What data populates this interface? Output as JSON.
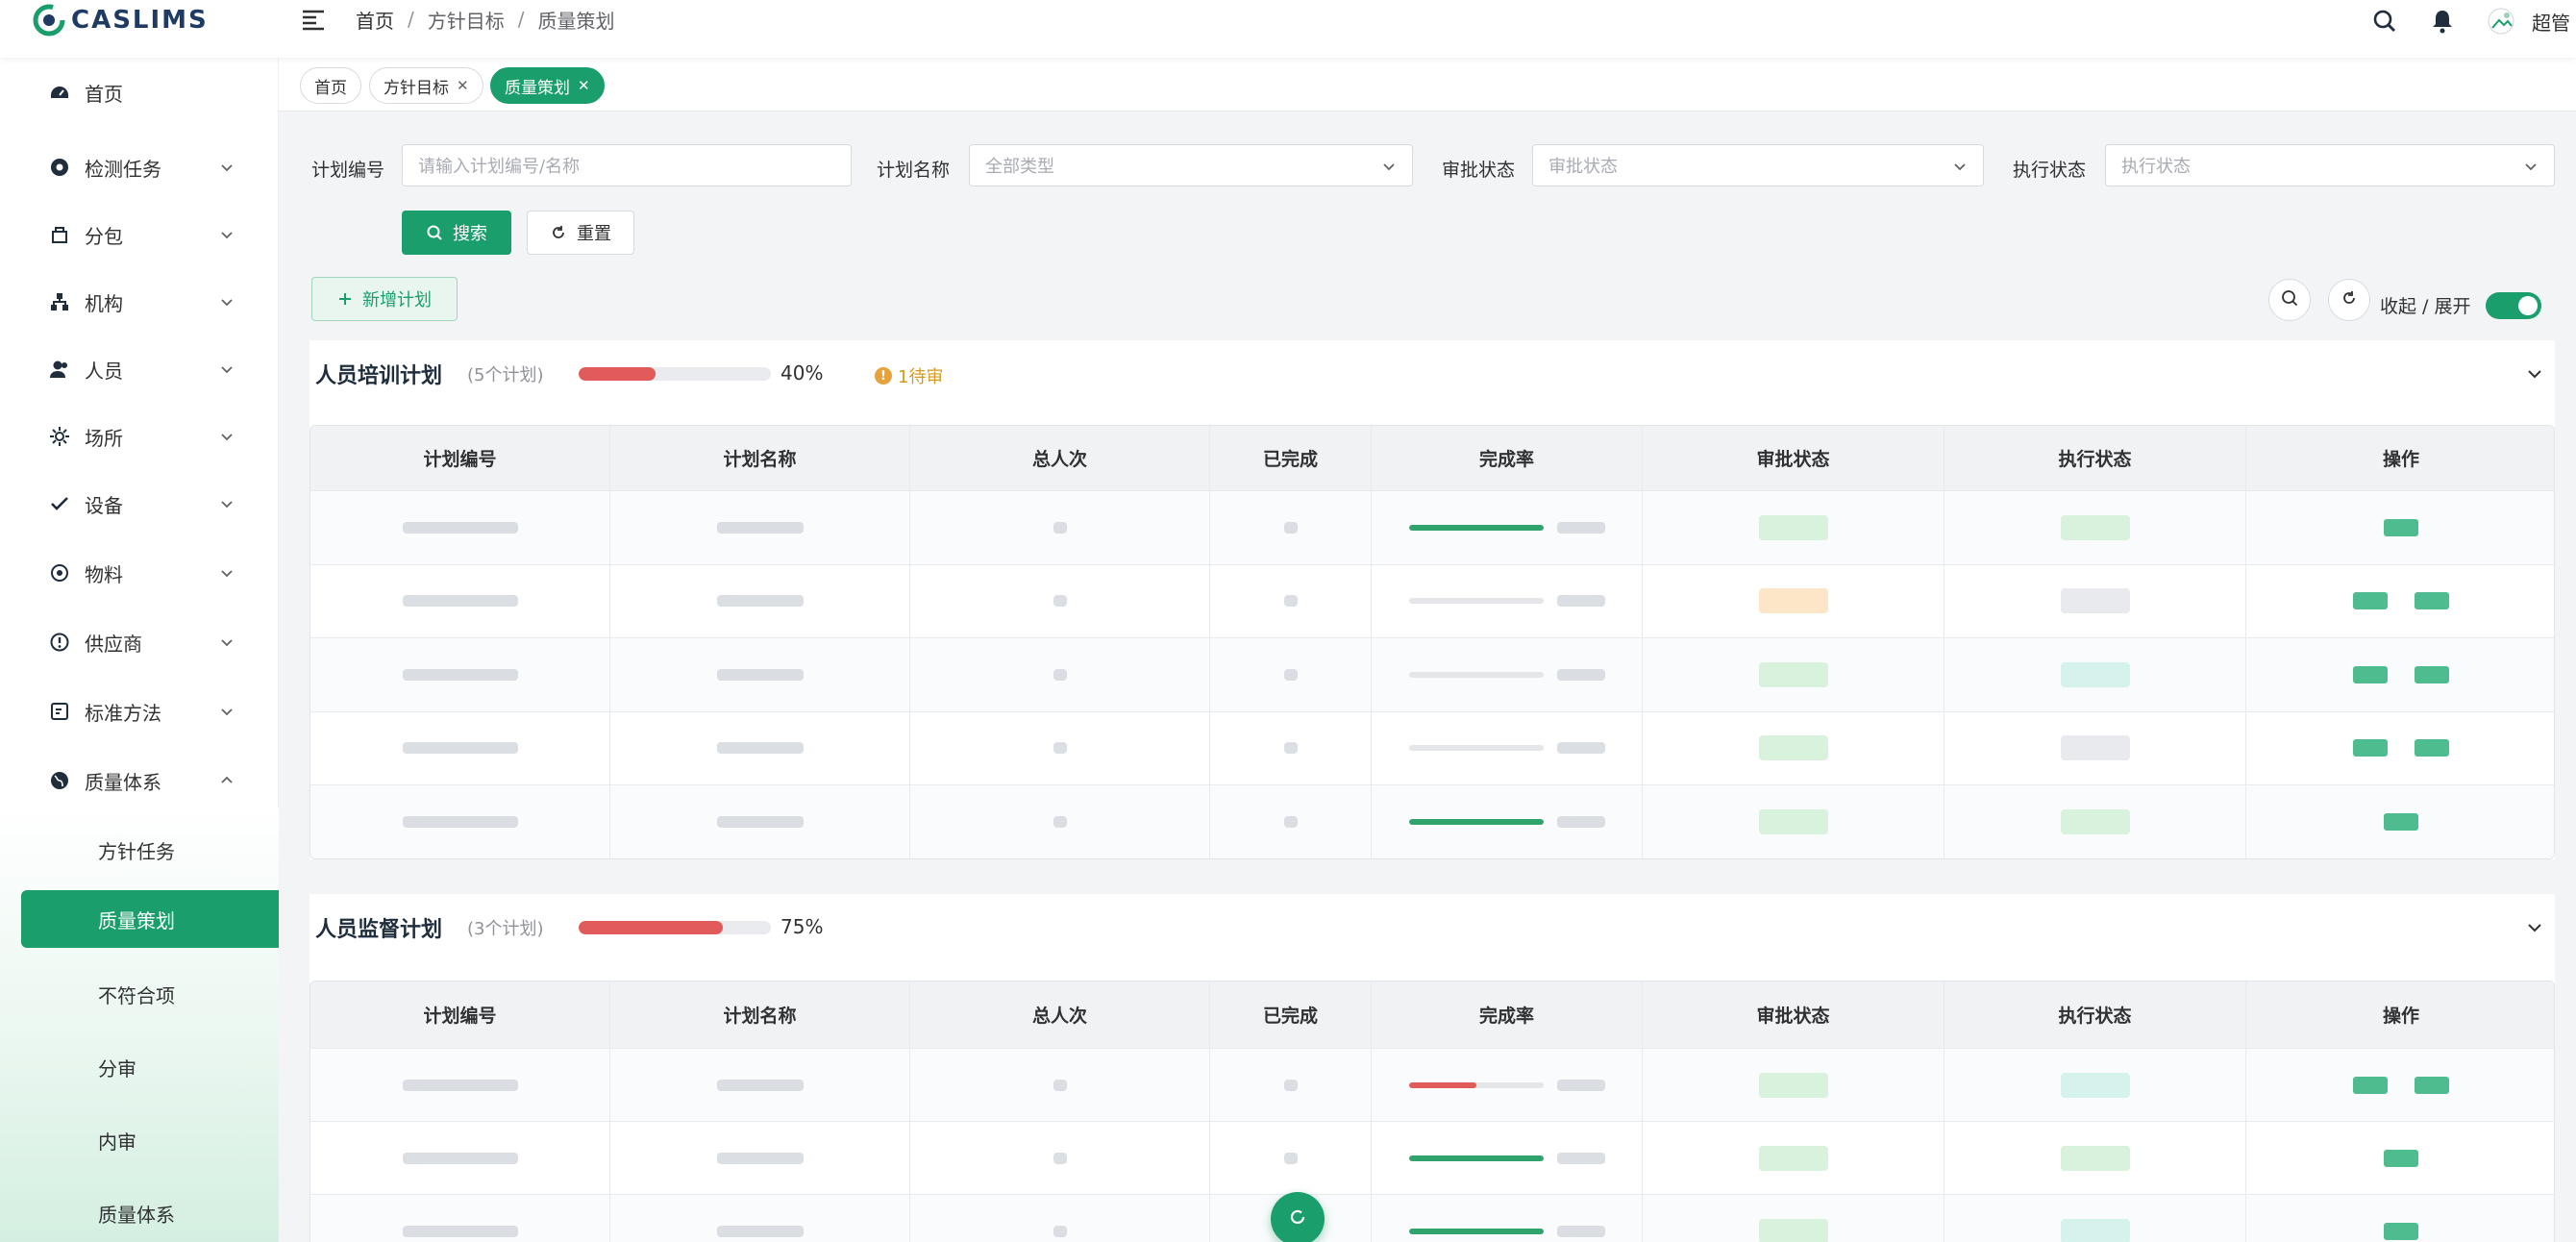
{
  "app": {
    "logo_text": "CASLIMS"
  },
  "breadcrumb": [
    "首页",
    "方针目标",
    "质量策划"
  ],
  "colors": {
    "accent": "#1a9e6c",
    "progress_low": "#e15b5b",
    "progress_done": "#2fa36b",
    "warning": "#e6a23c"
  },
  "header_icons": [
    "search-icon",
    "bell-icon",
    "avatar"
  ],
  "user": {
    "name": "超管"
  },
  "sidebar": {
    "items": [
      {
        "label": "首页",
        "icon": "dashboard-icon",
        "expandable": false
      },
      {
        "label": "检测任务",
        "icon": "task-icon",
        "expandable": true
      },
      {
        "label": "分包",
        "icon": "package-icon",
        "expandable": true
      },
      {
        "label": "机构",
        "icon": "org-icon",
        "expandable": true
      },
      {
        "label": "人员",
        "icon": "user-icon",
        "expandable": true
      },
      {
        "label": "场所",
        "icon": "place-icon",
        "expandable": true
      },
      {
        "label": "设备",
        "icon": "check-icon",
        "expandable": true
      },
      {
        "label": "物料",
        "icon": "material-icon",
        "expandable": true
      },
      {
        "label": "供应商",
        "icon": "supplier-icon",
        "expandable": true
      },
      {
        "label": "标准方法",
        "icon": "standard-icon",
        "expandable": true
      },
      {
        "label": "质量体系",
        "icon": "globe-icon",
        "expandable": true,
        "expanded": true
      }
    ],
    "sub_items": [
      {
        "label": "方针任务"
      },
      {
        "label": "质量策划",
        "active": true
      },
      {
        "label": "不符合项"
      },
      {
        "label": "分审"
      },
      {
        "label": "内审"
      },
      {
        "label": "质量体系"
      }
    ]
  },
  "tabs": [
    {
      "label": "首页",
      "closable": false
    },
    {
      "label": "方针目标",
      "closable": true
    },
    {
      "label": "质量策划",
      "closable": true,
      "active": true
    }
  ],
  "filters": {
    "plan_no": {
      "label": "计划编号",
      "placeholder": "请输入计划编号/名称"
    },
    "plan_name": {
      "label": "计划名称",
      "placeholder": "全部类型"
    },
    "approval": {
      "label": "审批状态",
      "placeholder": "审批状态"
    },
    "execution": {
      "label": "执行状态",
      "placeholder": "执行状态"
    },
    "search_label": "搜索",
    "reset_label": "重置"
  },
  "toolbar": {
    "add_label": "新增计划",
    "toggle_label": "收起 / 展开",
    "toggle_on": true
  },
  "table_columns": [
    "计划编号",
    "计划名称",
    "总人次",
    "已完成",
    "完成率",
    "审批状态",
    "执行状态",
    "操作"
  ],
  "sections": [
    {
      "title": "人员培训计划",
      "count_label": "(5个计划)",
      "progress": 0.4,
      "progress_label": "40%",
      "pending_label": "1待审",
      "rows": [
        {
          "rate": 1.0,
          "approval": "green",
          "execution": "green",
          "ops": 1
        },
        {
          "rate": 0.0,
          "approval": "orange",
          "execution": "grey",
          "ops": 2
        },
        {
          "rate": 0.0,
          "approval": "green",
          "execution": "teal",
          "ops": 2
        },
        {
          "rate": 0.0,
          "approval": "green",
          "execution": "grey",
          "ops": 2
        },
        {
          "rate": 1.0,
          "approval": "green",
          "execution": "green",
          "ops": 1
        }
      ]
    },
    {
      "title": "人员监督计划",
      "count_label": "(3个计划)",
      "progress": 0.75,
      "progress_label": "75%",
      "rows": [
        {
          "rate": 0.5,
          "approval": "green",
          "execution": "teal",
          "ops": 2
        },
        {
          "rate": 1.0,
          "approval": "green",
          "execution": "green",
          "ops": 1
        },
        {
          "rate": 1.0,
          "approval": "green",
          "execution": "teal",
          "ops": 1
        }
      ]
    }
  ]
}
